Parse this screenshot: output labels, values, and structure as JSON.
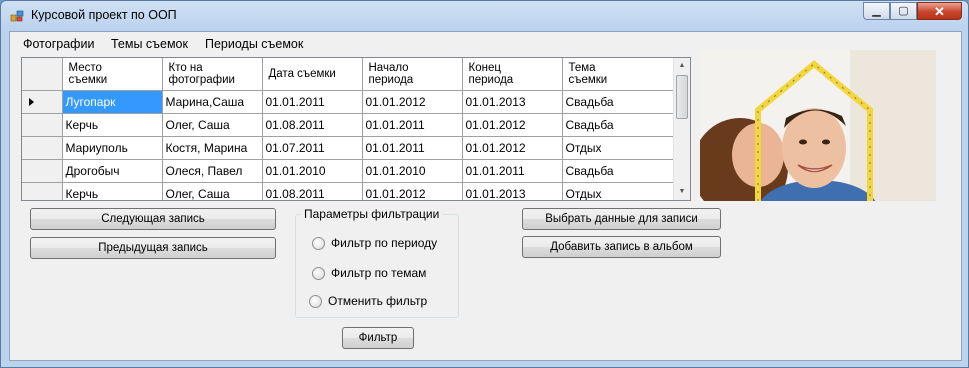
{
  "window": {
    "title": "Курсовой проект по ООП"
  },
  "caption": {
    "minimize": "▁",
    "maximize": "▢",
    "close": "✕"
  },
  "menu": {
    "items": [
      "Фотографии",
      "Темы съемок",
      "Периоды съемок"
    ]
  },
  "grid": {
    "columns": [
      {
        "line1": "Место",
        "line2": "съемки"
      },
      {
        "line1": "Кто на",
        "line2": "фотографии"
      },
      {
        "line1": "Дата съемки",
        "line2": ""
      },
      {
        "line1": "Начало",
        "line2": "периода"
      },
      {
        "line1": "Конец",
        "line2": "периода"
      },
      {
        "line1": "Тема",
        "line2": "съемки"
      }
    ],
    "rows": [
      [
        "Лугопарк",
        "Марина,Саша",
        "01.01.2011",
        "01.01.2012",
        "01.01.2013",
        "Свадьба"
      ],
      [
        "Керчь",
        "Олег, Саша",
        "01.08.2011",
        "01.01.2011",
        "01.01.2012",
        "Свадьба"
      ],
      [
        "Мариуполь",
        "Костя, Марина",
        "01.07.2011",
        "01.01.2011",
        "01.01.2012",
        "Отдых"
      ],
      [
        "Дрогобыч",
        "Олеся, Павел",
        "01.01.2010",
        "01.01.2010",
        "01.01.2011",
        "Свадьба"
      ],
      [
        "Керчь",
        "Олег, Саша",
        "01.08.2011",
        "01.01.2012",
        "01.01.2013",
        "Отдых"
      ]
    ],
    "selected_row": 0,
    "selected_col": 0
  },
  "buttons": {
    "next": "Следующая запись",
    "prev": "Предыдущая запись",
    "select_data": "Выбрать данные для записи",
    "add_record": "Добавить запись в альбом",
    "filter": "Фильтр"
  },
  "filter_group": {
    "title": "Параметры фильтрации",
    "options": [
      "Фильтр по периоду",
      "Фильтр по темам",
      "Отменить фильтр"
    ]
  },
  "colors": {
    "selection": "#3399ff",
    "close_button": "#c8452b",
    "ruler_yellow": "#f2d640"
  }
}
